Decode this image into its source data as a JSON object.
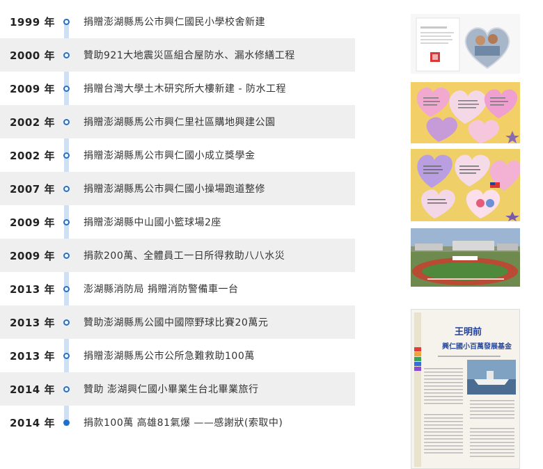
{
  "timeline": {
    "unit": "年",
    "entries": [
      {
        "year": "1999",
        "text": "捐贈澎湖縣馬公市興仁國民小學校舍新建"
      },
      {
        "year": "2000",
        "text": "贊助921大地震災區組合屋防水、漏水修繕工程"
      },
      {
        "year": "2009",
        "text": "捐贈台灣大學土木研究所大樓新建 - 防水工程"
      },
      {
        "year": "2002",
        "text": "捐贈澎湖縣馬公市興仁里社區購地興建公園"
      },
      {
        "year": "2002",
        "text": "捐贈澎湖縣馬公市興仁國小成立獎學金"
      },
      {
        "year": "2007",
        "text": "捐贈澎湖縣馬公市興仁國小操場跑道整修"
      },
      {
        "year": "2009",
        "text": "捐贈澎湖縣中山國小籃球場2座"
      },
      {
        "year": "2009",
        "text": "捐款200萬、全體員工一日所得救助八八水災"
      },
      {
        "year": "2013",
        "text": "澎湖縣消防局  捐贈消防警備車一台"
      },
      {
        "year": "2013",
        "text": "贊助澎湖縣馬公國中國際野球比賽20萬元"
      },
      {
        "year": "2013",
        "text": "捐贈澎湖縣馬公市公所急難救助100萬"
      },
      {
        "year": "2014",
        "text": "贊助 澎湖興仁國小畢業生台北畢業旅行"
      },
      {
        "year": "2014",
        "text": "捐款100萬 高雄81氣爆  ——感謝狀(索取中)"
      }
    ]
  },
  "photos": {
    "magazine": {
      "header": "王明前",
      "subtitle": "興仁國小百萬發展基金"
    }
  },
  "colors": {
    "accent": "#1f6fd0",
    "line": "#cfe0f2",
    "row_shade": "#efefef"
  }
}
